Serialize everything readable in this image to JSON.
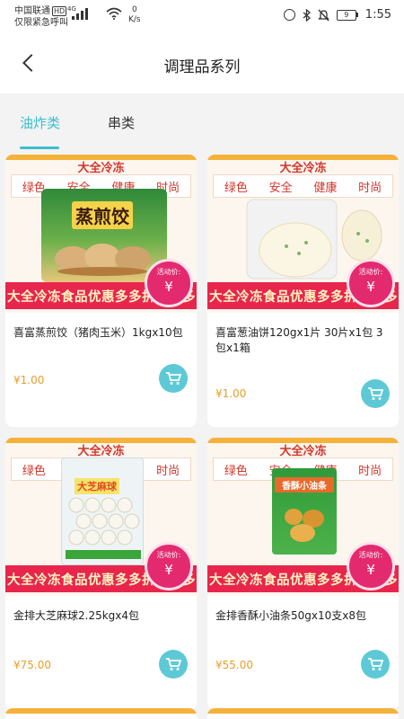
{
  "status_bar": {
    "carrier_line1": "中国联通",
    "hd": "HD",
    "carrier_line2": "仅限紧急呼叫",
    "network": "4G",
    "speed_value": "0",
    "speed_unit": "K/s",
    "battery": "9",
    "time": "1:55"
  },
  "nav": {
    "title": "调理品系列"
  },
  "tabs": [
    {
      "label": "油炸类",
      "active": true
    },
    {
      "label": "串类",
      "active": false
    }
  ],
  "banner": {
    "brand": "大全冷冻",
    "tag1": "绿色",
    "tag2": "安全",
    "tag3": "健康",
    "tag4": "时尚",
    "promo": "大全冷冻食品优惠多多折扣多多",
    "badge_label": "活动价:",
    "badge_symbol": "¥"
  },
  "products": [
    {
      "name": "喜富蒸煎饺（猪肉玉米）1kgx10包",
      "price": "¥1.00",
      "pic_text": "蒸煎饺"
    },
    {
      "name": "喜富葱油饼120gx1片 30片x1包  3包x1箱",
      "price": "¥1.00",
      "pic_text": ""
    },
    {
      "name": "金排大芝麻球2.25kgx4包",
      "price": "¥75.00",
      "pic_text": "大芝麻球"
    },
    {
      "name": "金排香酥小油条50gx10支x8包",
      "price": "¥55.00",
      "pic_text": "香酥小油条"
    }
  ],
  "colors": {
    "accent": "#3dbdd0",
    "price": "#e89d2a",
    "promo": "#e8264d",
    "cart": "#5ec9d6"
  }
}
